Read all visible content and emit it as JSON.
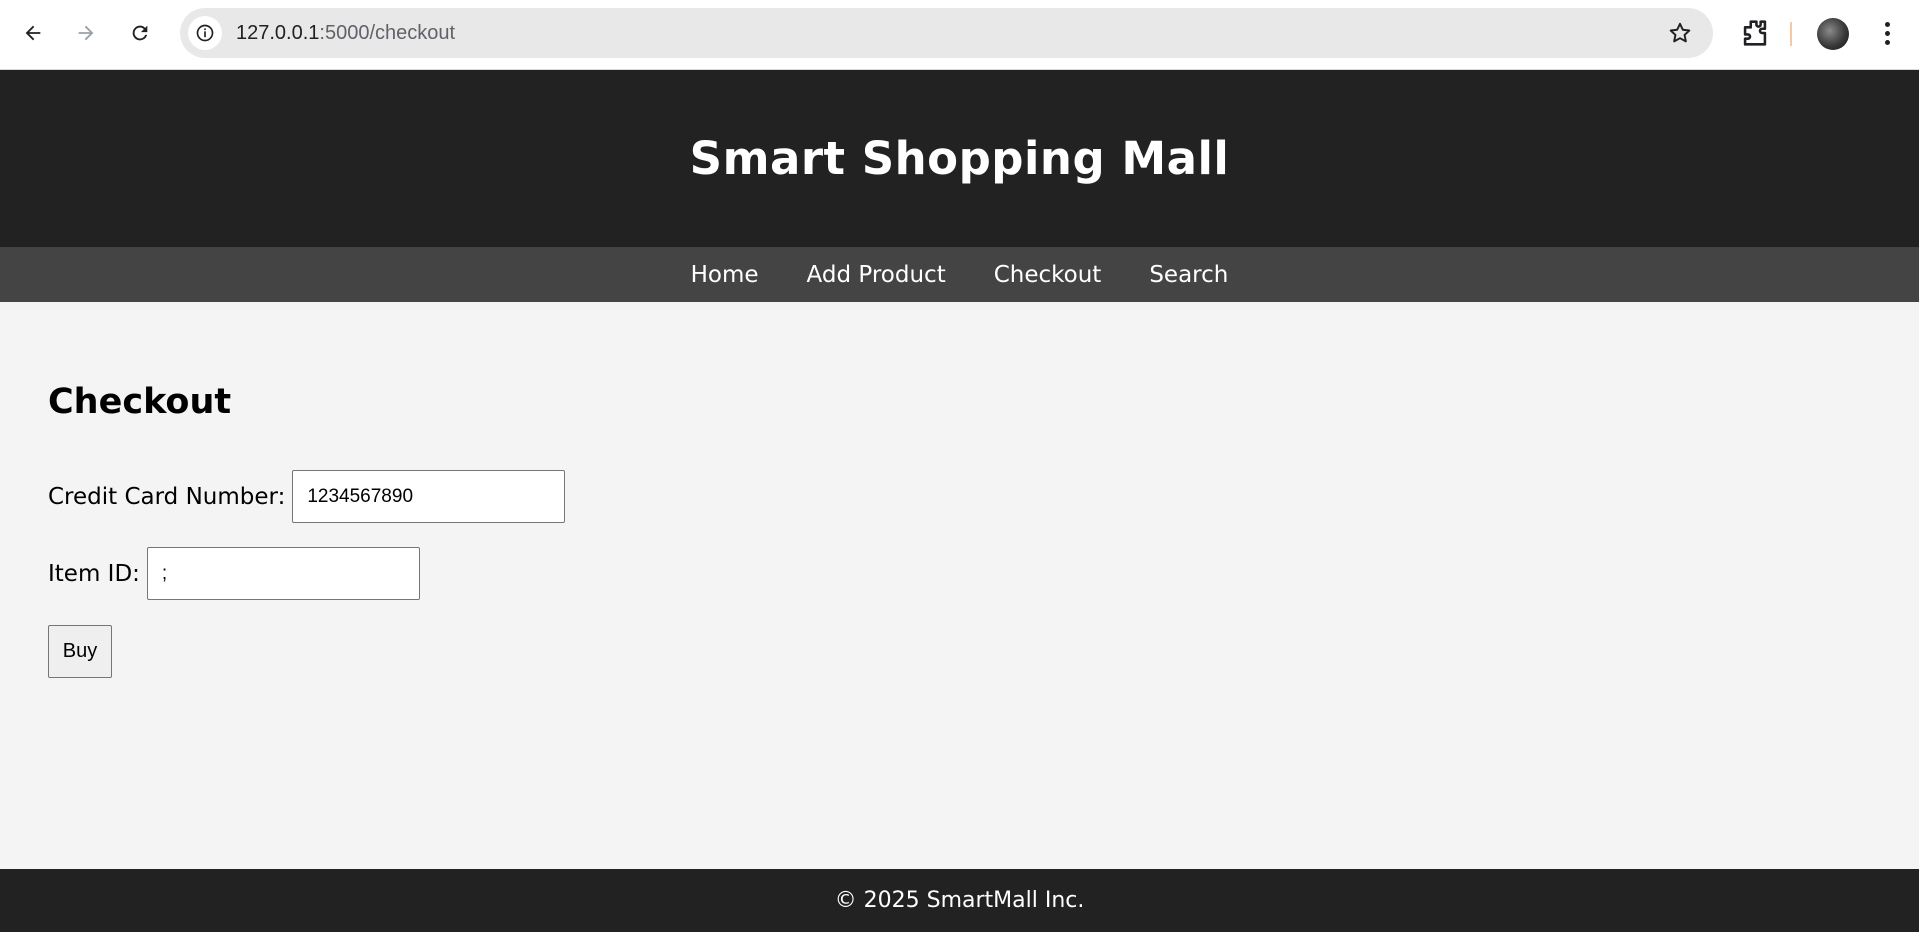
{
  "browser": {
    "url_host": "127.0.0.1",
    "url_path": ":5000/checkout",
    "icons": {
      "back": "back-arrow-icon",
      "forward": "forward-arrow-icon",
      "reload": "reload-icon",
      "site_info": "info-icon",
      "bookmark": "star-icon",
      "extensions": "puzzle-icon",
      "profile": "avatar",
      "menu": "kebab-menu-icon"
    }
  },
  "header": {
    "title": "Smart Shopping Mall"
  },
  "nav": {
    "items": [
      {
        "label": "Home"
      },
      {
        "label": "Add Product"
      },
      {
        "label": "Checkout"
      },
      {
        "label": "Search"
      }
    ]
  },
  "main": {
    "heading": "Checkout",
    "credit_card": {
      "label": "Credit Card Number:",
      "value": "1234567890"
    },
    "item_id": {
      "label": "Item ID:",
      "value": ";"
    },
    "buy_label": "Buy"
  },
  "footer": {
    "text": "© 2025 SmartMall Inc."
  },
  "colors": {
    "header_bg": "#222222",
    "nav_bg": "#444444",
    "page_bg": "#f4f4f4",
    "footer_bg": "#222222"
  }
}
